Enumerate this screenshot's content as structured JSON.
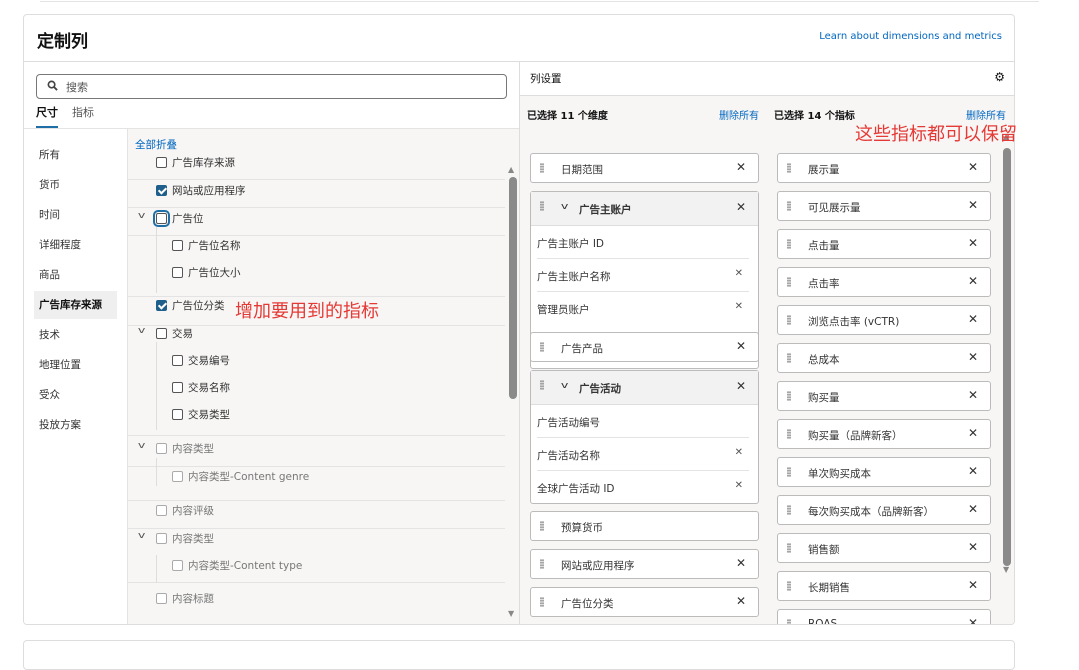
{
  "header": {
    "title": "定制列",
    "learn_link": "Learn about dimensions and metrics"
  },
  "search": {
    "placeholder": "搜索"
  },
  "tabs": [
    {
      "label": "尺寸",
      "active": true
    },
    {
      "label": "指标",
      "active": false
    }
  ],
  "nav": [
    {
      "label": "所有"
    },
    {
      "label": "货币"
    },
    {
      "label": "时间"
    },
    {
      "label": "详细程度"
    },
    {
      "label": "商品"
    },
    {
      "label": "广告库存来源",
      "active": true
    },
    {
      "label": "技术"
    },
    {
      "label": "地理位置"
    },
    {
      "label": "受众"
    },
    {
      "label": "投放方案"
    }
  ],
  "collapse_all": "全部折叠",
  "dimension_list": [
    {
      "label": "广告库存来源",
      "checked": false,
      "level": 0
    },
    {
      "label": "网站或应用程序",
      "checked": true,
      "level": 0
    },
    {
      "label": "广告位",
      "checked": false,
      "level": 0,
      "expandable": true,
      "focused": true
    },
    {
      "label": "广告位名称",
      "checked": false,
      "level": 1
    },
    {
      "label": "广告位大小",
      "checked": false,
      "level": 1
    },
    {
      "label": "广告位分类",
      "checked": true,
      "level": 0
    },
    {
      "label": "交易",
      "checked": false,
      "level": 0,
      "expandable": true
    },
    {
      "label": "交易编号",
      "checked": false,
      "level": 1
    },
    {
      "label": "交易名称",
      "checked": false,
      "level": 1
    },
    {
      "label": "交易类型",
      "checked": false,
      "level": 1
    },
    {
      "label": "内容类型",
      "checked": false,
      "level": 0,
      "expandable": true,
      "disabled": true
    },
    {
      "label": "内容类型-Content genre",
      "checked": false,
      "level": 1,
      "disabled": true
    },
    {
      "label": "内容评级",
      "checked": false,
      "level": 0,
      "disabled": true
    },
    {
      "label": "内容类型",
      "checked": false,
      "level": 0,
      "expandable": true,
      "disabled": true
    },
    {
      "label": "内容类型-Content type",
      "checked": false,
      "level": 1,
      "disabled": true
    },
    {
      "label": "内容标题",
      "checked": false,
      "level": 0,
      "disabled": true
    }
  ],
  "column_settings": {
    "title": "列设置",
    "dimensions_header": "已选择 11 个维度",
    "metrics_header": "已选择 14 个指标",
    "remove_all": "删除所有",
    "dimensions": [
      {
        "label": "日期范围"
      },
      {
        "label": "广告主账户",
        "children": [
          "广告主账户 ID",
          "广告主账户名称",
          "管理员账户"
        ]
      },
      {
        "label": "广告产品"
      },
      {
        "label": "广告活动",
        "children": [
          "广告活动编号",
          "广告活动名称",
          "全球广告活动 ID"
        ]
      },
      {
        "label": "预算货币",
        "removable": false
      },
      {
        "label": "网站或应用程序"
      },
      {
        "label": "广告位分类"
      }
    ],
    "metrics": [
      "展示量",
      "可见展示量",
      "点击量",
      "点击率",
      "浏览点击率 (vCTR)",
      "总成本",
      "购买量",
      "购买量（品牌新客）",
      "单次购买成本",
      "每次购买成本（品牌新客）",
      "销售额",
      "长期销售",
      "ROAS"
    ]
  },
  "annotations": {
    "left": "增加要用到的指标",
    "right": "这些指标都可以保留"
  },
  "icons": {
    "search": "search-icon",
    "settings": "gear-icon",
    "remove": "close-icon",
    "drag": "drag-handle-icon",
    "expand": "chevron-down-icon"
  },
  "colors": {
    "accent": "#1f5f8b",
    "link": "#0066c0",
    "annotation": "#e53935"
  }
}
